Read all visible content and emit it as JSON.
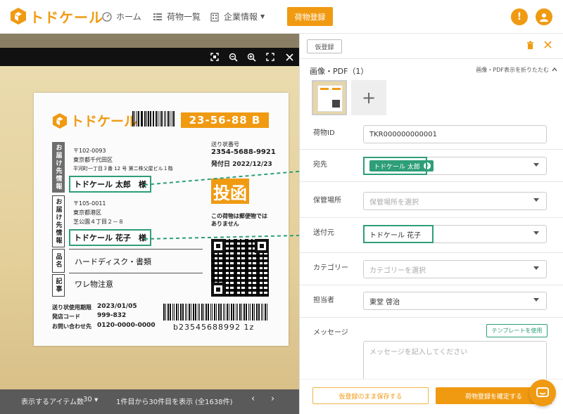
{
  "nav": {
    "logo": "トドケール",
    "home": "ホーム",
    "parcels": "荷物一覧",
    "company": "企業情報",
    "register_button": "荷物登録",
    "alert_icon": "!",
    "colors": {
      "accent": "#f09a12",
      "green": "#2e9e78"
    }
  },
  "label": {
    "logo": "トドケール",
    "code": "23-56-88 B",
    "to_tab": "お届け先情報",
    "from_tab": "お届け先情報",
    "item_tab": "品名",
    "note_tab": "記事",
    "to_zip": "〒102-0093",
    "to_addr1": "東京都千代田区",
    "to_addr2": "平河町一丁目３番 12 号 第二株父屋ビル１階",
    "to_name": "トドケール 太郎　様",
    "from_zip": "〒105-0011",
    "from_addr1": "東京都港区",
    "from_addr2": "芝公園４丁目２－８",
    "from_name": "トドケール 花子　様",
    "tracking_label": "送り状番号",
    "tracking_number": "2354-5688-9921",
    "ship_date": "発付日 2022/12/23",
    "toukan": "投函",
    "notice1": "この荷物は郵便物では",
    "notice2": "ありません",
    "item1": "ハードディスク・書類",
    "item2": "ワレ物注意",
    "expiry_label": "送り状使用期限",
    "expiry_value": "2023/01/05",
    "origin_label": "発店コード",
    "origin_value": "999-832",
    "contact_label": "お問い合わせ先",
    "contact_value": "0120-0000-0000",
    "barcode_text": "b23545688992 1z"
  },
  "pager": {
    "items_label": "表示するアイテム数",
    "items_value": "30",
    "range": "1件目から30件目を表示 (全1638件)",
    "prev": "‹",
    "next": "›"
  },
  "panel": {
    "draft_button": "仮登録",
    "section_title": "画像・PDF（1）",
    "collapse": "画像・PDF表示を折りたたむ",
    "add": "+",
    "fields": {
      "id_label": "荷物ID",
      "id_value": "TKR000000000001",
      "to_label": "宛先",
      "to_chip": "トドケール 太郎",
      "storage_label": "保管場所",
      "storage_placeholder": "保管場所を選択",
      "from_label": "送付元",
      "from_value": "トドケール 花子",
      "category_label": "カテゴリー",
      "category_placeholder": "カテゴリーを選択",
      "owner_label": "担当者",
      "owner_value": "東堂 啓治",
      "message_label": "メッセージ",
      "template_button": "テンプレートを使用",
      "message_placeholder": "メッセージを記入してください"
    },
    "save_draft_button": "仮登録のまま保存する",
    "confirm_button": "荷物登録を確定する"
  }
}
